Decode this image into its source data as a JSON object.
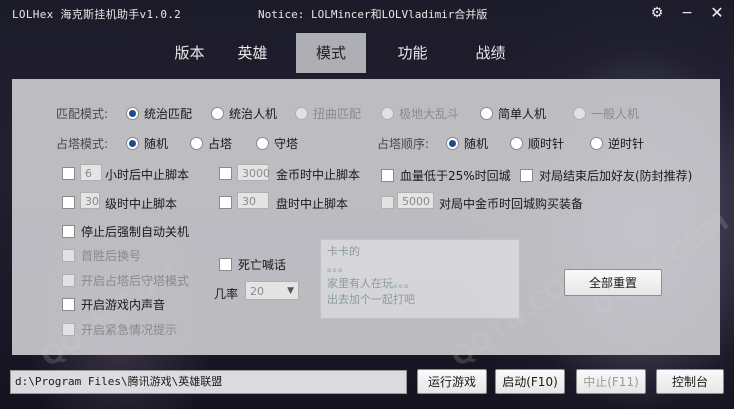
{
  "window": {
    "title": "LOLHex 海克斯挂机助手v1.0.2",
    "notice": "Notice: LOLMincer和LOLVladimir合并版"
  },
  "icons": {
    "settings": "gear-icon",
    "minimize": "minimize-icon",
    "close": "close-icon"
  },
  "tabs": [
    {
      "label": "版本",
      "active": false
    },
    {
      "label": "英雄",
      "active": false
    },
    {
      "label": "模式",
      "active": true
    },
    {
      "label": "功能",
      "active": false
    },
    {
      "label": "战绩",
      "active": false
    }
  ],
  "match_mode": {
    "label": "匹配模式:",
    "options": [
      {
        "label": "统治匹配",
        "selected": true,
        "enabled": true
      },
      {
        "label": "统治人机",
        "selected": false,
        "enabled": true
      },
      {
        "label": "扭曲匹配",
        "selected": false,
        "enabled": false
      },
      {
        "label": "极地大乱斗",
        "selected": false,
        "enabled": false
      },
      {
        "label": "简单人机",
        "selected": false,
        "enabled": true
      },
      {
        "label": "一般人机",
        "selected": false,
        "enabled": false
      }
    ]
  },
  "tower_mode": {
    "label": "占塔模式:",
    "options": [
      {
        "label": "随机",
        "selected": true
      },
      {
        "label": "占塔",
        "selected": false
      },
      {
        "label": "守塔",
        "selected": false
      }
    ]
  },
  "tower_order": {
    "label": "占塔顺序:",
    "options": [
      {
        "label": "随机",
        "selected": true
      },
      {
        "label": "顺时针",
        "selected": false
      },
      {
        "label": "逆时针",
        "selected": false
      }
    ]
  },
  "stop_conditions": {
    "hours": {
      "value": "6",
      "label": "小时后中止脚本"
    },
    "gold": {
      "value": "3000",
      "label": "金币时中止脚本"
    },
    "hp": {
      "label": "血量低于25%时回城"
    },
    "add_friend": {
      "label": "对局结束后加好友(防封推荐)"
    },
    "level": {
      "value": "30",
      "label": "级时中止脚本"
    },
    "games": {
      "value": "30",
      "label": "盘时中止脚本"
    },
    "buy": {
      "value": "5000",
      "label": "对局中金币时回城购买装备"
    }
  },
  "options": {
    "shutdown": "停止后强制自动关机",
    "first_win": "首胜后换号",
    "defend_after_capture": "开启占塔后守塔模式",
    "game_sound": "开启游戏内声音",
    "emergency": "开启紧急情况提示",
    "death_chat": "死亡喊话",
    "probability_label": "几率",
    "probability_value": "20"
  },
  "chat_text": {
    "line1": "卡卡的",
    "line2": "。。。",
    "line3": "家里有人在玩。。。",
    "line4": "出去加个一起打吧"
  },
  "reset_button": "全部重置",
  "game_path": "d:\\Program Files\\腾讯游戏\\英雄联盟",
  "bottom_buttons": {
    "run_game": "运行游戏",
    "start": "启动(F10)",
    "stop": "中止(F11)",
    "console": "控制台"
  },
  "watermark": "QQTN.COM"
}
